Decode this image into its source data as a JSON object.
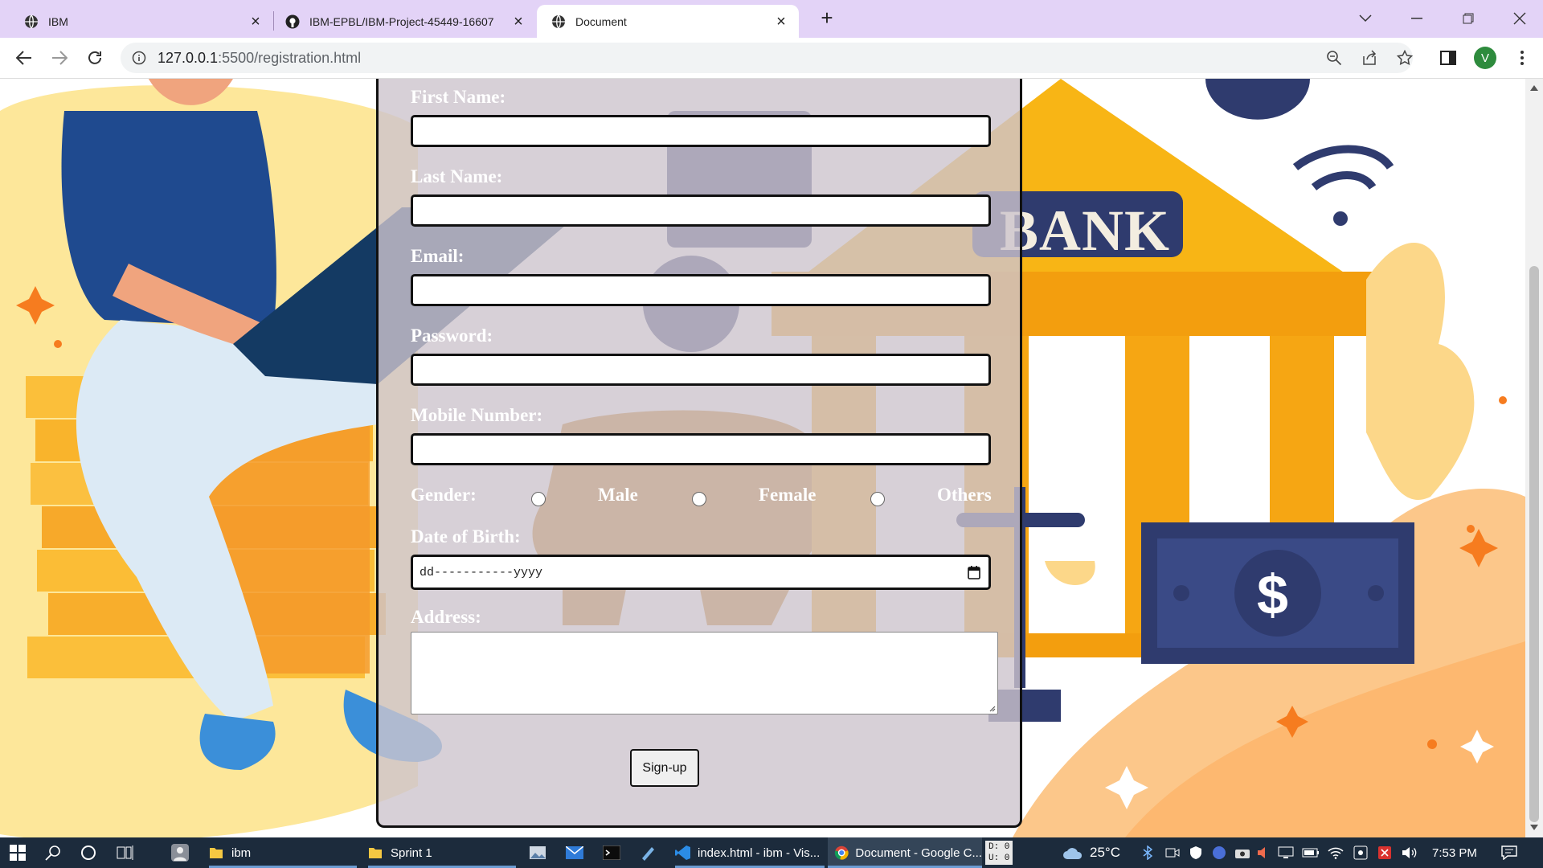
{
  "browser": {
    "tabs": [
      {
        "title": "IBM",
        "icon": "globe-icon",
        "active": false
      },
      {
        "title": "IBM-EPBL/IBM-Project-45449-16607",
        "icon": "github-icon",
        "active": false
      },
      {
        "title": "Document",
        "icon": "globe-icon",
        "active": true
      }
    ],
    "url_host": "127.0.0.1",
    "url_rest": ":5500/registration.html",
    "profile_initial": "V"
  },
  "page": {
    "background_text": "BANK",
    "form": {
      "first_name_label": "First Name:",
      "last_name_label": "Last Name:",
      "email_label": "Email:",
      "password_label": "Password:",
      "mobile_label": "Mobile Number:",
      "gender_label": "Gender:",
      "gender_options": [
        "Male",
        "Female",
        "Others"
      ],
      "dob_label": "Date of Birth:",
      "dob_placeholder": "dd-----------yyyy",
      "address_label": "Address:",
      "submit_label": "Sign-up",
      "first_name_value": "",
      "last_name_value": "",
      "email_value": "",
      "password_value": "",
      "mobile_value": "",
      "address_value": ""
    }
  },
  "taskbar": {
    "items": [
      {
        "label": "",
        "icon": "user-app-icon"
      },
      {
        "label": "ibm",
        "icon": "folder-icon"
      },
      {
        "label": "Sprint 1",
        "icon": "folder-icon"
      },
      {
        "label": "",
        "icon": "photos-icon"
      },
      {
        "label": "",
        "icon": "mail-icon"
      },
      {
        "label": "",
        "icon": "terminal-icon"
      },
      {
        "label": "",
        "icon": "notes-icon"
      },
      {
        "label": "index.html - ibm - Vis...",
        "icon": "vscode-icon"
      },
      {
        "label": "Document - Google C...",
        "icon": "chrome-icon"
      }
    ],
    "net_d": "D: 0",
    "net_u": "U: 0",
    "temperature": "25°C",
    "time": "7:53 PM"
  },
  "colors": {
    "tabstrip": "#e3d3f7",
    "bank_yellow": "#f8b515",
    "bank_navy": "#2f3b6e",
    "taskbar": "#1c2b3c"
  }
}
